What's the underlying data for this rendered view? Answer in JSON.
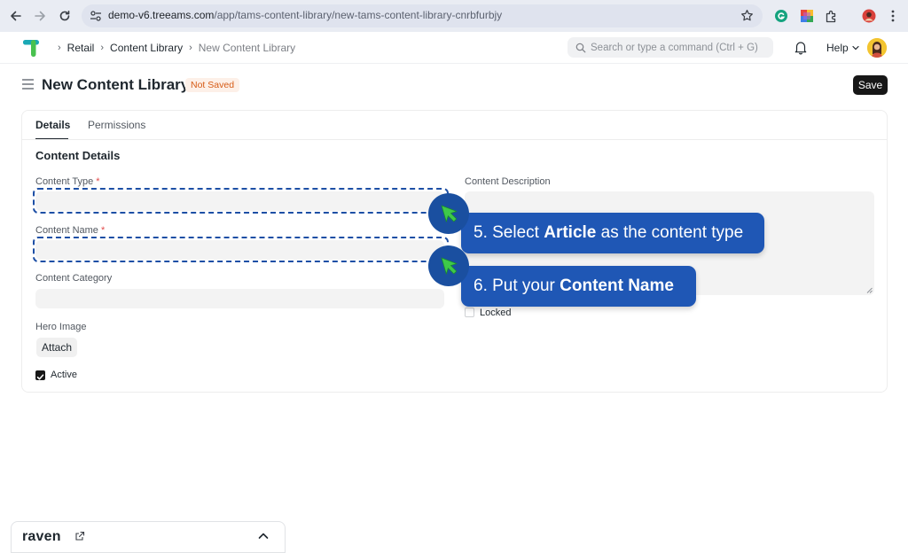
{
  "browser": {
    "url_host": "demo-v6.treeams.com",
    "url_path": "/app/tams-content-library/new-tams-content-library-cnrbfurbjy"
  },
  "header": {
    "breadcrumbs": [
      "Retail",
      "Content Library",
      "New Content Library"
    ],
    "search_placeholder": "Search or type a command (Ctrl + G)",
    "help_label": "Help"
  },
  "page": {
    "title": "New Content Library",
    "status": "Not Saved",
    "save_label": "Save"
  },
  "form": {
    "tabs": [
      {
        "label": "Details",
        "active": true
      },
      {
        "label": "Permissions",
        "active": false
      }
    ],
    "section_title": "Content Details",
    "fields": {
      "content_type": {
        "label": "Content Type",
        "required": "*",
        "value": ""
      },
      "content_name": {
        "label": "Content Name",
        "required": "*",
        "value": ""
      },
      "content_category": {
        "label": "Content Category",
        "value": ""
      },
      "content_description": {
        "label": "Content Description",
        "value": ""
      },
      "hero_image": {
        "label": "Hero Image",
        "button": "Attach"
      },
      "active": {
        "label": "Active",
        "checked": true
      },
      "locked": {
        "label": "Locked",
        "checked": false
      }
    }
  },
  "tutorial": {
    "step5": {
      "prefix": "5. Select ",
      "bold": "Article",
      "suffix": " as the content type"
    },
    "step6": {
      "prefix": "6. Put your ",
      "bold": "Content Name",
      "suffix": ""
    }
  },
  "raven": {
    "name": "raven"
  },
  "colors": {
    "accent": "#1f57b5",
    "pointer_green": "#3ec94a",
    "badge_text": "#d65b16",
    "badge_bg": "#fdf0e8",
    "logo_teal": "#1aa8b5",
    "logo_green": "#49c14f"
  },
  "icons": [
    "back-arrow-icon",
    "forward-arrow-icon",
    "reload-icon",
    "site-settings-icon",
    "star-icon",
    "grammarly-icon",
    "color-extension-icon",
    "puzzle-icon",
    "profile-icon",
    "kebab-menu-icon",
    "search-icon",
    "bell-icon",
    "chevron-down-icon",
    "hamburger-icon",
    "cursor-pointer-icon",
    "external-link-icon",
    "chevron-up-icon"
  ]
}
